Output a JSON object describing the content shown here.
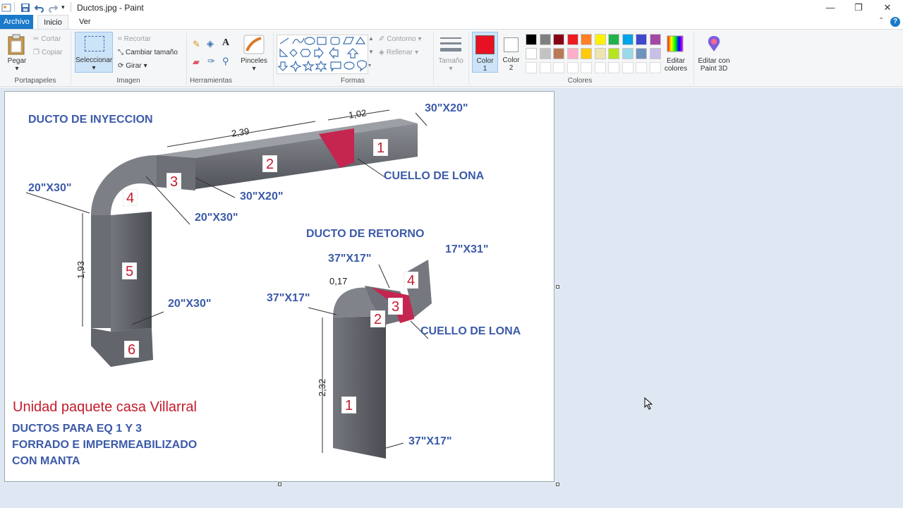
{
  "window": {
    "title": "Ductos.jpg - Paint",
    "minimize": "—",
    "restore": "❐",
    "close": "✕"
  },
  "menu": {
    "file": "Archivo",
    "home": "Inicio",
    "view": "Ver"
  },
  "clipboard": {
    "paste": "Pegar",
    "cut": "Cortar",
    "copy": "Copiar",
    "group": "Portapapeles"
  },
  "image": {
    "select": "Seleccionar",
    "crop": "Recortar",
    "resize": "Cambiar tamaño",
    "rotate": "Girar",
    "group": "Imagen"
  },
  "tools": {
    "group": "Herramientas",
    "brushes": "Pinceles"
  },
  "shapes": {
    "outline": "Contorno",
    "fill": "Rellenar",
    "group": "Formas"
  },
  "size": {
    "label": "Tamaño"
  },
  "colors": {
    "color1_label": "Color",
    "color1_num": "1",
    "color2_label": "Color",
    "color2_num": "2",
    "edit": "Editar colores",
    "group": "Colores",
    "paint3d": "Editar con Paint 3D",
    "color1_value": "#e81123",
    "color2_value": "#ffffff",
    "palette_row1": [
      "#000000",
      "#7f7f7f",
      "#880015",
      "#ed1c24",
      "#ff7f27",
      "#fff200",
      "#22b14c",
      "#00a2e8",
      "#3f48cc",
      "#a349a4"
    ],
    "palette_row2": [
      "#ffffff",
      "#c3c3c3",
      "#b97a57",
      "#ffaec9",
      "#ffc90e",
      "#efe4b0",
      "#b5e61d",
      "#99d9ea",
      "#7092be",
      "#c8bfe7"
    ]
  },
  "drawing": {
    "inj_title": "DUCTO DE INYECCION",
    "ret_title": "DUCTO DE RETORNO",
    "inj_neck": "CUELLO DE LONA",
    "ret_neck": "CUELLO DE LONA",
    "d_30x20_top": "30\"X20\"",
    "d_30x20_mid": "30\"X20\"",
    "d_20x30_left": "20\"X30\"",
    "d_20x30_mid": "20\"X30\"",
    "d_20x30_low": "20\"X30\"",
    "d_37x17_a": "37\"X17\"",
    "d_37x17_b": "37\"X17\"",
    "d_37x17_c": "37\"X17\"",
    "d_17x31": "17\"X31\"",
    "len_239": "2,39",
    "len_102": "1,02",
    "len_193": "1,93",
    "len_232": "2,32",
    "len_017": "0,17",
    "n1": "1",
    "n2": "2",
    "n3": "3",
    "n4": "4",
    "n5": "5",
    "n6": "6",
    "r1": "1",
    "r2": "2",
    "r3": "3",
    "r4": "4",
    "note_red": "Unidad paquete casa Villarral",
    "note_1": "DUCTOS PARA EQ 1 Y 3",
    "note_2": "FORRADO E IMPERMEABILIZADO",
    "note_3": "CON MANTA"
  }
}
